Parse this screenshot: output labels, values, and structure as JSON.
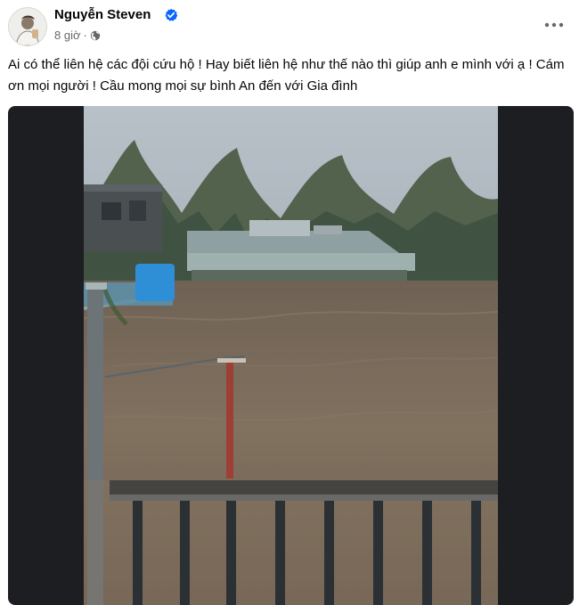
{
  "post": {
    "author": "Nguyễn Steven",
    "time": "8 giờ",
    "separator": "·",
    "text": "Ai có thể liên hệ các đội cứu hộ ! Hay biết liên hệ như thế nào thì giúp anh e mình với ạ ! Cám ơn mọi người ! Cầu mong mọi sự bình An đến với Gia đình",
    "icons": {
      "verified": "verified-badge-icon",
      "privacy": "globe-icon",
      "menu": "more-options-icon"
    },
    "colors": {
      "verified": "#0866ff",
      "meta_text": "#65676b",
      "media_background": "#1c1e21"
    }
  }
}
